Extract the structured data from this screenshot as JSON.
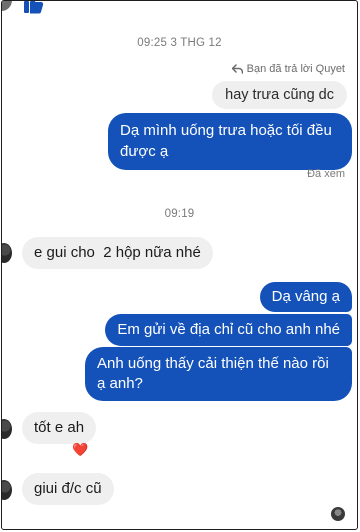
{
  "conversation": {
    "timestamp_1": "09:25 3 THG 12",
    "reply_note": "Bạn đã trả lời Quyet",
    "quoted_message": "hay trưa cũng dc",
    "msg_out_1": "Dạ mình uống trưa hoặc tối đều được ạ",
    "seen_label": "Đã xem",
    "timestamp_2": "09:19",
    "msg_in_1": "e gui cho  2 hộp nữa nhé",
    "msg_out_2": "Dạ vâng ạ",
    "msg_out_3": "Em gửi về địa chỉ cũ cho anh nhé",
    "msg_out_4": "Anh uống thấy cải thiện thế nào rồi ạ anh?",
    "msg_in_2": "tốt e ah",
    "reaction": "❤️",
    "msg_in_3": "giui đ/c cũ"
  },
  "colors": {
    "outgoing_bubble": "#1452b9",
    "incoming_bubble": "#efefef",
    "like_icon": "#1452b9"
  },
  "icons": {
    "like": "thumbs-up-icon",
    "reply": "reply-arrow-icon",
    "reaction": "heart-icon"
  }
}
